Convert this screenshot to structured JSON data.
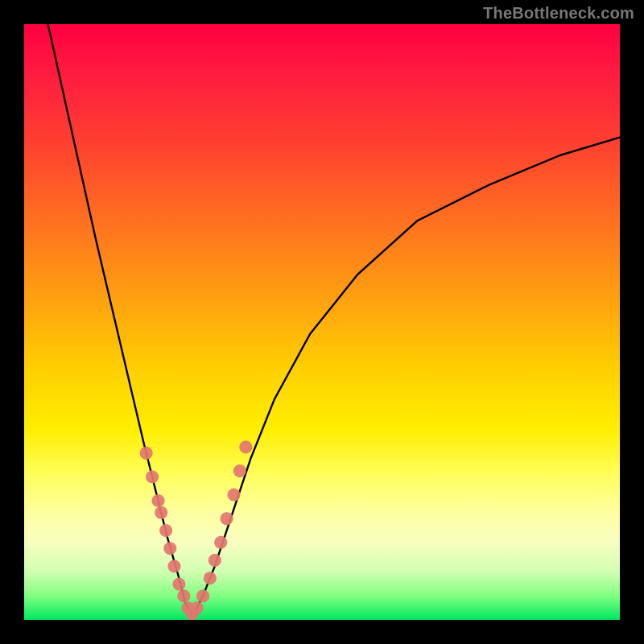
{
  "watermark": "TheBottleneck.com",
  "chart_data": {
    "type": "line",
    "title": "",
    "xlabel": "",
    "ylabel": "",
    "xlim": [
      0,
      100
    ],
    "ylim": [
      0,
      100
    ],
    "notes": "Background is a vertical gradient from red (top, high bottleneck) through orange/yellow to green (bottom, no bottleneck). Curve is a V-shaped bottleneck profile with minimum near x≈28. Pink dot markers cluster near the minimum on both flanks.",
    "series": [
      {
        "name": "bottleneck-curve",
        "x": [
          4,
          8,
          12,
          16,
          20,
          22,
          24,
          26,
          27,
          28,
          29,
          30,
          32,
          34,
          36,
          38,
          42,
          48,
          56,
          66,
          78,
          90,
          100
        ],
        "values": [
          100,
          82,
          64,
          47,
          30,
          22,
          14,
          7,
          3,
          1,
          2,
          4,
          9,
          15,
          21,
          27,
          37,
          48,
          58,
          67,
          73,
          78,
          81
        ]
      },
      {
        "name": "sample-points",
        "x": [
          20.5,
          21.5,
          22.5,
          23.0,
          23.8,
          24.5,
          25.2,
          26.0,
          26.8,
          27.5,
          28.2,
          29.0,
          30.0,
          31.2,
          32.0,
          33.0,
          34.0,
          35.2,
          36.2,
          37.2
        ],
        "values": [
          28,
          24,
          20,
          18,
          15,
          12,
          9,
          6,
          4,
          2,
          1,
          2,
          4,
          7,
          10,
          13,
          17,
          21,
          25,
          29
        ]
      }
    ]
  }
}
